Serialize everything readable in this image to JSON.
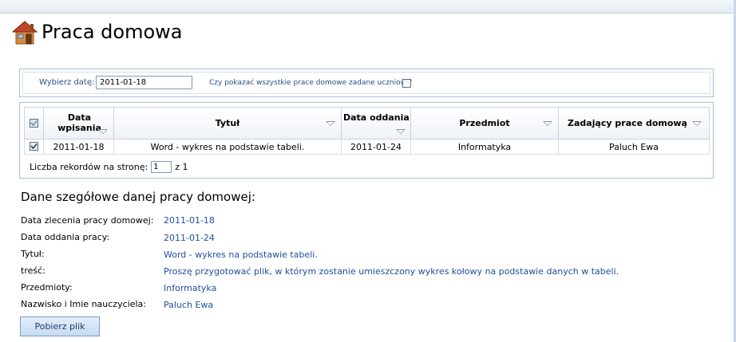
{
  "page": {
    "title": "Praca domowa"
  },
  "filter": {
    "date_label": "Wybierz datę:",
    "date_value": "2011-01-18",
    "show_all_label": "Czy pokazać wszystkie prace domowe zadane uczniowi?",
    "show_all_checked": false
  },
  "grid": {
    "select_all_checked": true,
    "columns": [
      "Data wpisania",
      "Tytuł",
      "Data oddania",
      "Przedmiot",
      "Zadający prace domową"
    ],
    "rows": [
      {
        "checked": true,
        "cells": [
          "2011-01-18",
          "Word - wykres na podstawie tabeli.",
          "2011-01-24",
          "Informatyka",
          "Paluch Ewa"
        ]
      }
    ],
    "pager": {
      "label": "Liczba rekordów na stronę:",
      "value": "1",
      "of": "z 1"
    }
  },
  "details": {
    "title": "Dane szegółowe danej pracy domowej:",
    "fields": [
      {
        "label": "Data zlecenia pracy domowej:",
        "value": "2011-01-18"
      },
      {
        "label": "Data oddania pracy:",
        "value": "2011-01-24"
      },
      {
        "label": "Tytuł:",
        "value": "Word - wykres na podstawie tabeli."
      },
      {
        "label": "treść:",
        "value": "Proszę przygotować plik, w którym zostanie umieszczony wykres kołowy na podstawie danych w tabeli."
      },
      {
        "label": "Przedmioty:",
        "value": "Informatyka"
      },
      {
        "label": "Nazwisko i Imie nauczyciela:",
        "value": "Paluch Ewa"
      }
    ]
  },
  "actions": {
    "download_label": "Pobierz plik"
  },
  "icons": {
    "title_icon": "house-icon",
    "sort_icon": "sort-arrow-icon"
  },
  "colors": {
    "link": "#1f4e9c",
    "border": "#aac0d8"
  }
}
